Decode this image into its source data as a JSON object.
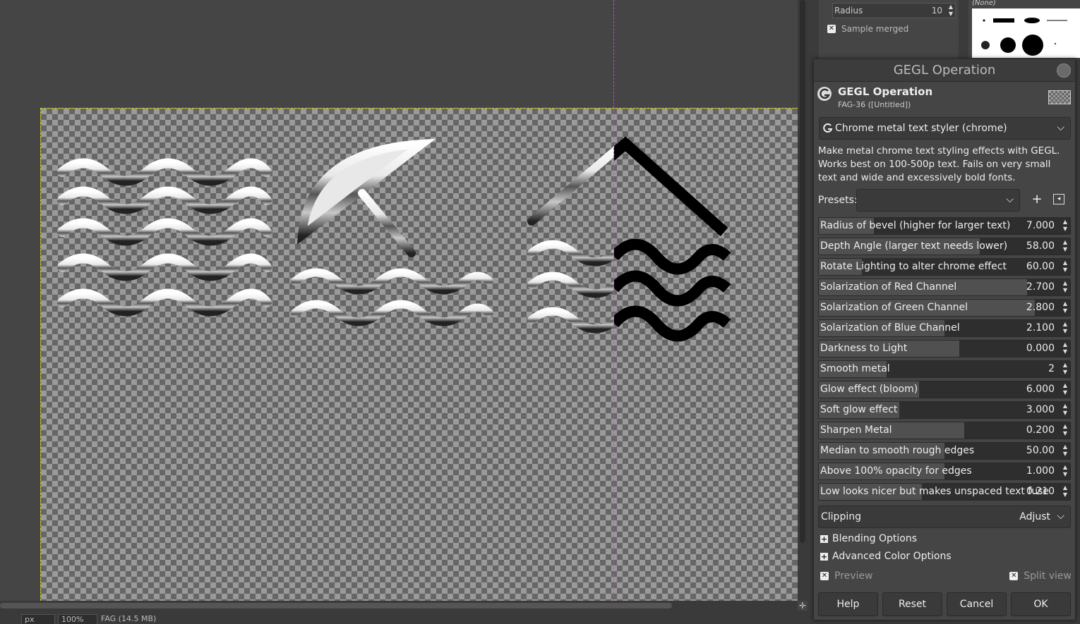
{
  "tool_options": {
    "radius_label": "Radius",
    "radius_value": "10",
    "sample_merged_label": "Sample merged",
    "sample_merged_checked": true
  },
  "brushes": {
    "selected_label": "(None)"
  },
  "statusbar": {
    "unit": "px",
    "zoom": "100%",
    "info": "FAG (14.5 MB)"
  },
  "dialog": {
    "window_title": "GEGL Operation",
    "header_title": "GEGL Operation",
    "header_subtitle": "FAG-36 ([Untitled])",
    "operation": "Chrome metal text styler (chrome)",
    "description": "Make metal chrome text styling effects with GEGL. Works best on 100-500p text. Fails on very small text and wide and excessively bold fonts.",
    "presets_label": "Presets:",
    "presets_value": "",
    "params": [
      {
        "label": "Radius of bevel (higher for larger text)",
        "value": "7.000",
        "fill": 0.22
      },
      {
        "label": "Depth Angle (larger text needs lower)",
        "value": "58.00",
        "fill": 0.64
      },
      {
        "label": "Rotate Lighting to alter chrome effect",
        "value": "60.00",
        "fill": 0.17
      },
      {
        "label": "Solarization of Red Channel",
        "value": "2.700",
        "fill": 0.83
      },
      {
        "label": "Solarization of Green Channel",
        "value": "2.800",
        "fill": 0.86
      },
      {
        "label": "Solarization of Blue Channel",
        "value": "2.100",
        "fill": 0.5
      },
      {
        "label": "Darkness to Light",
        "value": "0.000",
        "fill": 0.56
      },
      {
        "label": "Smooth metal",
        "value": "2",
        "fill": 0.27
      },
      {
        "label": "Glow effect (bloom)",
        "value": "6.000",
        "fill": 0.4
      },
      {
        "label": "Soft glow effect",
        "value": "3.000",
        "fill": 0.32
      },
      {
        "label": "Sharpen Metal",
        "value": "0.200",
        "fill": 0.58
      },
      {
        "label": "Median to smooth rough edges",
        "value": "50.00",
        "fill": 0.5
      },
      {
        "label": "Above 100% opacity for edges",
        "value": "1.000",
        "fill": 0.5
      },
      {
        "label": "Low looks nicer but makes unspaced text fuse",
        "value": "0.210",
        "fill": 0.41
      }
    ],
    "clipping_label": "Clipping",
    "clipping_value": "Adjust",
    "blending_options": "Blending Options",
    "advanced_color_options": "Advanced Color Options",
    "preview_label": "Preview",
    "preview_checked": true,
    "split_view_label": "Split view",
    "split_view_checked": true,
    "buttons": {
      "help": "Help",
      "reset": "Reset",
      "cancel": "Cancel",
      "ok": "OK"
    }
  }
}
